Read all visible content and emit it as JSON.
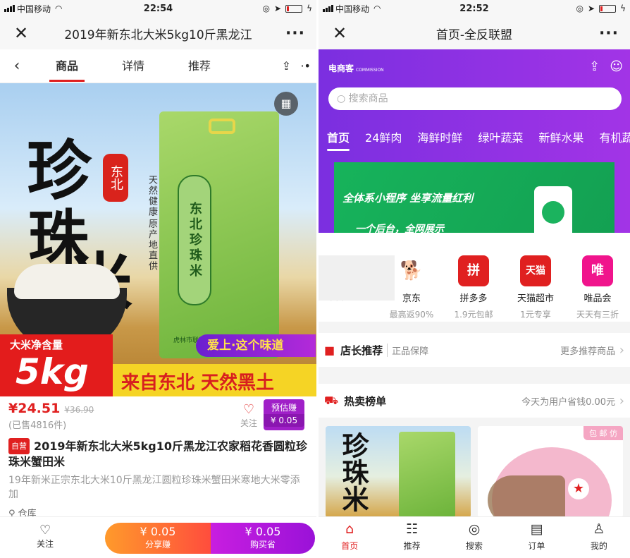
{
  "left": {
    "status": {
      "carrier": "中国移动",
      "time": "22:54"
    },
    "title": "2019年新东北大米5kg10斤黑龙江",
    "tabs": [
      "商品",
      "详情",
      "推荐"
    ],
    "hero": {
      "big1": "珍",
      "big2": "珠",
      "big3": "米",
      "seal": "东北",
      "side1": "天然健康",
      "side2": "原产地直供",
      "bag_label": "东北珍珠米",
      "bag_small": "虎林市联利盛米业有限责任公司",
      "net_label": "大米净含量",
      "net_value": "5kg",
      "slogan1": "爱上·这个味道",
      "slogan2": "来自东北 天然黑土"
    },
    "price": "¥24.51",
    "orig_price": "¥36.90",
    "sold": "(已售4816件)",
    "fav_label": "关注",
    "est_label": "预估赚",
    "est_value": "¥ 0.05",
    "self_tag": "自营",
    "product_title": "2019年新东北大米5kg10斤黑龙江农家稻花香圆粒珍珠米蟹田米",
    "product_desc": "19年新米正宗东北大米10斤黑龙江圆粒珍珠米蟹田米寒地大米零添加",
    "location": "仓库",
    "bottom": {
      "fav": "关注",
      "share_val": "¥ 0.05",
      "share_lbl": "分享赚",
      "buy_val": "¥ 0.05",
      "buy_lbl": "购买省"
    }
  },
  "right": {
    "status": {
      "carrier": "中国移动",
      "time": "22:52"
    },
    "title": "首页-全反联盟",
    "brand": "电商客",
    "brand_small": "COMMISSION",
    "search_placeholder": "搜索商品",
    "categories": [
      "首页",
      "24鲜肉",
      "海鲜时鲜",
      "绿叶蔬菜",
      "新鲜水果",
      "有机蔬"
    ],
    "banner": {
      "line1": "全体系小程序 坐享流量红利",
      "line2": "一个后台，全网展示"
    },
    "shops": [
      {
        "name": "",
        "sub": "最高返90%",
        "icon": "",
        "color": "#ffffff"
      },
      {
        "name": "京东",
        "sub": "最高返90%",
        "icon": "🐕",
        "color": "#ffffff"
      },
      {
        "name": "拼多多",
        "sub": "1.9元包邮",
        "icon": "拼",
        "color": "#e02020"
      },
      {
        "name": "天猫超市",
        "sub": "1元专享",
        "icon": "天猫",
        "color": "#e02020"
      },
      {
        "name": "唯品会",
        "sub": "天天有三折",
        "icon": "唯",
        "color": "#f0148c"
      }
    ],
    "recommend": {
      "title": "店长推荐",
      "sub": "正品保障",
      "more": "更多推荐商品"
    },
    "hot": {
      "title": "热卖榜单",
      "more": "今天为用户省钱0.00元"
    },
    "card1": {
      "text": "珍珠米"
    },
    "card2": {
      "tag": "包 邮 仿"
    },
    "nav": [
      "首页",
      "推荐",
      "搜索",
      "订单",
      "我的"
    ]
  }
}
